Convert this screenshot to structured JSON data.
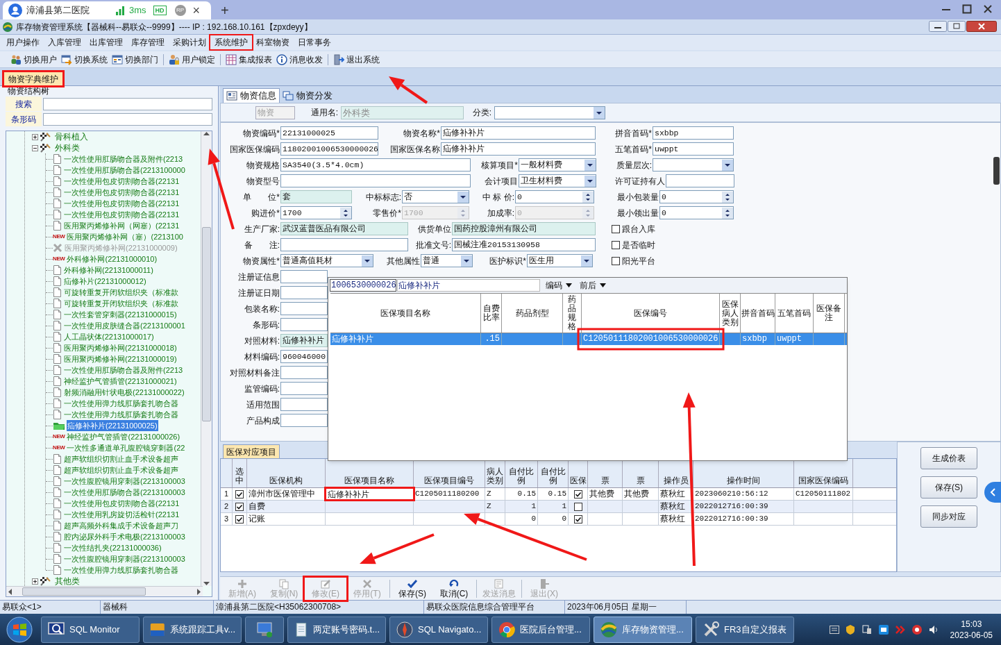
{
  "browser_tab": {
    "title": "漳浦县第二医院",
    "latency": "3ms",
    "quality": "HD",
    "profile": "RP",
    "close": "×",
    "new_tab": "+"
  },
  "window": {
    "title": "库存物资管理系统【器械科--易联众--9999】---- IP : 192.168.10.161【zpxdeyy】"
  },
  "menu": [
    "用户操作",
    "入库管理",
    "出库管理",
    "库存管理",
    "采购计划",
    "系统维护",
    "科室物资",
    "日常事务"
  ],
  "toolbar": [
    {
      "label": "切换用户",
      "kind": "users"
    },
    {
      "label": "切换系统",
      "kind": "switch"
    },
    {
      "label": "切换部门",
      "kind": "dept"
    },
    {
      "label": "用户锁定",
      "kind": "lock"
    },
    {
      "label": "集成报表",
      "kind": "report"
    },
    {
      "label": "消息收发",
      "kind": "info"
    },
    {
      "label": "退出系统",
      "kind": "exit"
    }
  ],
  "doc_tabs": [
    {
      "label": "物资字典维护",
      "selected": true
    }
  ],
  "tree_panel": {
    "title": "物资结构树",
    "search_label": "搜索",
    "barcode_label": "条形码",
    "nodes": [
      {
        "label": "骨科植入",
        "expanded": false,
        "selected": false
      },
      {
        "label": "外科类",
        "expanded": true,
        "selected": false,
        "children": [
          {
            "label": "一次性使用肛肠吻合器及附件(2213",
            "kind": "doc",
            "selected": false
          },
          {
            "label": "一次性使用肛肠吻合器(2213100000",
            "kind": "doc",
            "selected": false
          },
          {
            "label": "一次性使用包皮切割吻合器(22131",
            "kind": "doc",
            "selected": false
          },
          {
            "label": "一次性使用包皮切割吻合器(22131",
            "kind": "doc",
            "selected": false
          },
          {
            "label": "一次性使用包皮切割吻合器(22131",
            "kind": "doc",
            "selected": false
          },
          {
            "label": "一次性使用包皮切割吻合器(22131",
            "kind": "doc",
            "selected": false
          },
          {
            "label": "医用聚丙烯修补网（网塞）(22131",
            "kind": "doc",
            "selected": false
          },
          {
            "label": "医用聚丙烯修补网（塞）(2213100",
            "kind": "new",
            "badge": "NEW",
            "selected": false
          },
          {
            "label": "医用聚丙烯修补网(22131000009)",
            "kind": "deleted",
            "selected": false
          },
          {
            "label": "外科修补网(22131000010)",
            "kind": "new",
            "badge": "NEW",
            "selected": false
          },
          {
            "label": "外科修补网(22131000011)",
            "kind": "doc",
            "selected": false
          },
          {
            "label": "疝修补片(22131000012)",
            "kind": "doc",
            "selected": false
          },
          {
            "label": "可旋转重复开闭软组织夹（标准款",
            "kind": "doc",
            "selected": false
          },
          {
            "label": "可旋转重复开闭软组织夹（标准款",
            "kind": "doc",
            "selected": false
          },
          {
            "label": "一次性套管穿刺器(22131000015)",
            "kind": "doc",
            "selected": false
          },
          {
            "label": "一次性使用皮肤缝合器(2213100001",
            "kind": "doc",
            "selected": false
          },
          {
            "label": "人工晶状体(22131000017)",
            "kind": "doc",
            "selected": false
          },
          {
            "label": "医用聚丙烯修补网(22131000018)",
            "kind": "doc",
            "selected": false
          },
          {
            "label": "医用聚丙烯修补网(22131000019)",
            "kind": "doc",
            "selected": false
          },
          {
            "label": "一次性使用肛肠吻合器及附件(2213",
            "kind": "doc",
            "selected": false
          },
          {
            "label": "神经监护气管插管(22131000021)",
            "kind": "doc",
            "selected": false
          },
          {
            "label": "射频消融用针状电极(22131000022)",
            "kind": "doc",
            "selected": false
          },
          {
            "label": "一次性使用弹力线肛肠套扎吻合器",
            "kind": "doc",
            "selected": false
          },
          {
            "label": "一次性使用弹力线肛肠套扎吻合器",
            "kind": "doc",
            "selected": false
          },
          {
            "label": "疝修补补片(22131000025)",
            "kind": "folder",
            "selected": true
          },
          {
            "label": "神经监护气管插管(22131000026)",
            "kind": "new",
            "badge": "NEW",
            "selected": false
          },
          {
            "label": "一次性多通道单孔腹腔镜穿刺器(22",
            "kind": "new",
            "badge": "NEW",
            "selected": false
          },
          {
            "label": "超声软组织切割止血手术设备超声",
            "kind": "doc",
            "selected": false
          },
          {
            "label": "超声软组织切割止血手术设备超声",
            "kind": "doc",
            "selected": false
          },
          {
            "label": "一次性腹腔镜用穿刺器(2213100003",
            "kind": "doc",
            "selected": false
          },
          {
            "label": "一次性使用肛肠吻合器(2213100003",
            "kind": "doc",
            "selected": false
          },
          {
            "label": "一次性使用包皮切割吻合器(22131",
            "kind": "doc",
            "selected": false
          },
          {
            "label": "一次性使用乳房旋切活检针(22131",
            "kind": "doc",
            "selected": false
          },
          {
            "label": "超声高频外科集成手术设备超声刀",
            "kind": "doc",
            "selected": false
          },
          {
            "label": "腔内泌尿外科手术电极(2213100003",
            "kind": "doc",
            "selected": false
          },
          {
            "label": "一次性结扎夹(22131000036)",
            "kind": "doc",
            "selected": false
          },
          {
            "label": "一次性腹腔镜用穿刺器(2213100003",
            "kind": "doc",
            "selected": false
          },
          {
            "label": "一次性使用弹力线肛肠套扎吻合器",
            "kind": "doc",
            "selected": false
          }
        ]
      },
      {
        "label": "其他类",
        "expanded": false,
        "selected": false
      }
    ]
  },
  "detail_tabs": [
    {
      "label": "物资信息",
      "selected": true
    },
    {
      "label": "物资分发",
      "selected": false
    }
  ],
  "header_row": {
    "type_field": "物资",
    "generic_label": "通用名:",
    "generic_value": "外科类",
    "category_label": "分类:"
  },
  "form": {
    "rows": [
      [
        {
          "label": "物资编码*",
          "value": "22131000025",
          "kind": "text",
          "disabled": false
        },
        {
          "label": "物资名称*",
          "value": "疝修补补片",
          "kind": "text",
          "disabled": false
        },
        {
          "label": "拼音首码*",
          "value": "sxbbp",
          "kind": "text",
          "disabled": false
        }
      ],
      [
        {
          "label": "国家医保编码",
          "value": "11802001006530000026",
          "kind": "text",
          "disabled": false
        },
        {
          "label": "国家医保名称",
          "value": "疝修补补片",
          "kind": "text",
          "disabled": false
        },
        {
          "label": "五笔首码*",
          "value": "uwppt",
          "kind": "text",
          "disabled": false
        }
      ],
      [
        {
          "label": "物资规格",
          "value": "SA3540(3.5*4.0cm)",
          "kind": "text",
          "disabled": false
        },
        {
          "label": "核算项目*",
          "value": "一般材料费",
          "kind": "select",
          "disabled": false
        },
        {
          "label": "质量层次:",
          "kind": "select",
          "disabled": false
        }
      ],
      [
        {
          "label": "物资型号",
          "kind": "text",
          "disabled": false
        },
        {
          "label": "会计项目",
          "value": "卫生材料费",
          "kind": "select",
          "disabled": false
        },
        {
          "label": "许可证持有人",
          "kind": "text",
          "disabled": false
        }
      ],
      [
        {
          "label": "单　　位*",
          "value": "套",
          "kind": "lookup",
          "disabled": false
        },
        {
          "label": "中标标志:",
          "value": "否",
          "kind": "select",
          "disabled": false
        },
        {
          "label": "中 标 价:",
          "value": "0",
          "kind": "spin",
          "disabled": false
        },
        {
          "label": "最小包装量",
          "value": "0",
          "kind": "spin",
          "disabled": false
        }
      ],
      [
        {
          "label": "购进价*",
          "value": "1700",
          "kind": "spin",
          "disabled": false
        },
        {
          "label": "零售价*",
          "value": "1700",
          "kind": "spin",
          "disabled": true
        },
        {
          "label": "加成率:",
          "value": "0",
          "kind": "spin",
          "disabled": true
        },
        {
          "label": "最小领出量",
          "value": "0",
          "kind": "spin",
          "disabled": false
        }
      ],
      [
        {
          "label": "生产厂家:",
          "value": "武汉蓝普医品有限公司",
          "kind": "lookup",
          "disabled": false
        },
        {
          "label": "供货单位",
          "value": "国药控股漳州有限公司",
          "kind": "lookup",
          "disabled": false
        }
      ],
      [
        {
          "label": "备　　注:",
          "kind": "text",
          "disabled": false
        },
        {
          "label": "批准文号:",
          "value": "国械注准20153130958",
          "kind": "text",
          "disabled": false
        }
      ],
      [
        {
          "label": "物资属性*",
          "value": "普通高值耗材",
          "kind": "select",
          "disabled": false
        },
        {
          "label": "其他属性",
          "value": "普通",
          "kind": "select",
          "disabled": false
        },
        {
          "label": "医护标识*",
          "value": "医生用",
          "kind": "select",
          "disabled": false
        }
      ],
      [
        {
          "label": "注册证信息",
          "kind": "text",
          "disabled": false
        }
      ],
      [
        {
          "label": "注册证日期",
          "kind": "text",
          "disabled": false
        }
      ],
      [
        {
          "label": "包装名称:",
          "kind": "text",
          "disabled": false
        }
      ],
      [
        {
          "label": "条形码:",
          "kind": "text",
          "disabled": false
        }
      ],
      [
        {
          "label": "对照材料:",
          "value": "疝修补补片",
          "kind": "lookup",
          "disabled": false
        }
      ],
      [
        {
          "label": "材料编码:",
          "value": "960046000",
          "kind": "text",
          "disabled": false
        }
      ],
      [
        {
          "label": "对照材料备注",
          "kind": "text",
          "disabled": false
        }
      ],
      [
        {
          "label": "监管编码:",
          "kind": "text",
          "disabled": false
        }
      ],
      [
        {
          "label": "适用范围",
          "kind": "text",
          "disabled": false
        }
      ],
      [
        {
          "label": "产品构成",
          "kind": "text",
          "disabled": false
        }
      ]
    ],
    "flags": [
      {
        "label": "跟台入库",
        "checked": false
      },
      {
        "label": "是否临时",
        "checked": false
      },
      {
        "label": "阳光平台",
        "checked": false
      }
    ]
  },
  "lookup_popup": {
    "code": "1006530000026",
    "name": "疝修补补片",
    "filters": [
      "编码",
      "前后"
    ],
    "columns": [
      "医保项目名称",
      "自费比率",
      "药品剂型",
      "药品规格",
      "医保编号",
      "医保病人类别",
      "拼音首码",
      "五笔首码",
      "医保备注"
    ],
    "rows": [
      {
        "selected": true,
        "cells": [
          "疝修补补片",
          ".15",
          "",
          "",
          "C12050111802001006530000026",
          "",
          "sxbbp",
          "uwppt",
          ""
        ]
      }
    ]
  },
  "mapping_tab": "医保对应项目",
  "mapping_table": {
    "columns": [
      "选中",
      "医保机构",
      "医保项目名称",
      "医保项目编号",
      "病人类别",
      "自付比例",
      "自付比例",
      "医保",
      "票",
      "票",
      "操作员",
      "操作时间",
      "国家医保编码"
    ],
    "rows": [
      {
        "no": "1",
        "checked": true,
        "org": "漳州市医保管理中",
        "name": "疝修补补片",
        "code": "C1205011180200",
        "patient_type": "Z",
        "ratio_1": "0.15",
        "ratio_2": "0.15",
        "insured": true,
        "invoice_1": "其他费",
        "invoice_2": "其他费",
        "operator": "蔡秋红",
        "time": "2023060210:56:12",
        "national_code": "C12050111802",
        "editing": true
      },
      {
        "no": "2",
        "checked": true,
        "org": "自费",
        "patient_type": "Z",
        "ratio_1": "1",
        "ratio_2": "1",
        "insured": false,
        "operator": "蔡秋红",
        "time": "2022012716:00:39",
        "editing": false
      },
      {
        "no": "3",
        "checked": true,
        "org": "记账",
        "ratio_1": "0",
        "ratio_2": "0",
        "insured": true,
        "operator": "蔡秋红",
        "time": "2022012716:00:39",
        "editing": false
      }
    ]
  },
  "side_buttons": [
    "生成价表",
    "保存(S)",
    "同步对应"
  ],
  "actions": [
    {
      "label": "新增(A)",
      "kind": "add",
      "disabled": true
    },
    {
      "label": "复制(N)",
      "kind": "copy",
      "disabled": true
    },
    {
      "label": "修改(E)",
      "kind": "edit",
      "disabled": true
    },
    {
      "label": "停用(T)",
      "kind": "stop",
      "disabled": true
    },
    {
      "label": "保存(S)",
      "kind": "save",
      "disabled": false
    },
    {
      "label": "取消(C)",
      "kind": "cancel",
      "disabled": false
    },
    {
      "label": "发送消息",
      "kind": "message",
      "disabled": true
    },
    {
      "label": "退出(X)",
      "kind": "exit",
      "disabled": true
    }
  ],
  "status_bar": [
    "易联众<1>",
    "器械科",
    "漳浦县第二医院<H35062300708>",
    "易联众医院信息综合管理平台",
    "2023年06月05日 星期一"
  ],
  "taskbar": {
    "items": [
      {
        "label": "SQL Monitor",
        "kind": "monitor",
        "selected": false
      },
      {
        "label": "系统跟踪工具v...",
        "kind": "sql",
        "selected": false
      },
      {
        "kind": "computer",
        "selected": false
      },
      {
        "label": "两定账号密码.t...",
        "kind": "notepad",
        "selected": false
      },
      {
        "label": "SQL Navigato...",
        "kind": "compass",
        "selected": false
      },
      {
        "label": "医院后台管理...",
        "kind": "chrome",
        "selected": false
      },
      {
        "label": "库存物资管理...",
        "kind": "sphere",
        "selected": true
      },
      {
        "label": "FR3自定义报表",
        "kind": "tools",
        "selected": false
      }
    ],
    "time": "15:03",
    "date": "2023-06-05"
  }
}
